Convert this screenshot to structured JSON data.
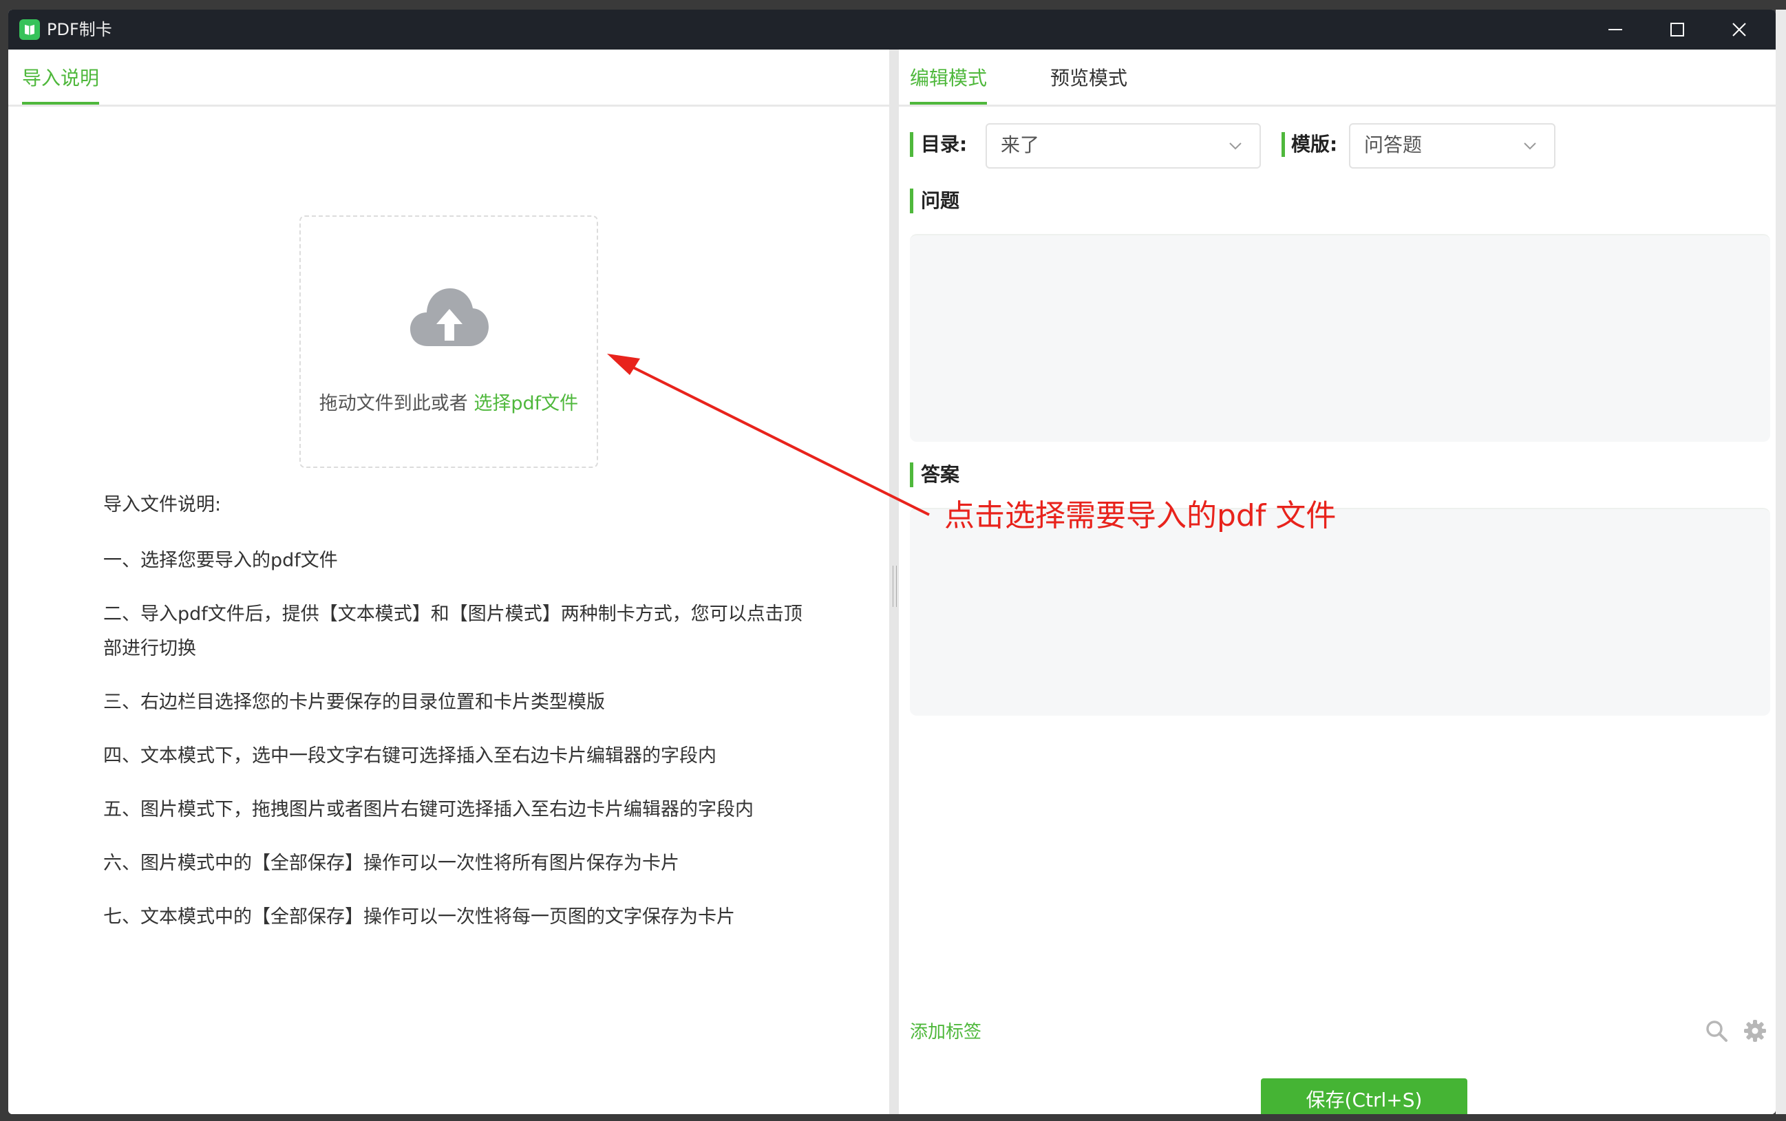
{
  "window": {
    "title": "PDF制卡"
  },
  "left_panel": {
    "tabs": [
      {
        "label": "导入说明",
        "active": true
      }
    ],
    "upload": {
      "text": "拖动文件到此或者",
      "link": "选择pdf文件",
      "icon": "cloud-upload-icon"
    },
    "instructions": {
      "title": "导入文件说明:",
      "items": [
        "一、选择您要导入的pdf文件",
        "二、导入pdf文件后，提供【文本模式】和【图片模式】两种制卡方式，您可以点击顶部进行切换",
        "三、右边栏目选择您的卡片要保存的目录位置和卡片类型模版",
        "四、文本模式下，选中一段文字右键可选择插入至右边卡片编辑器的字段内",
        "五、图片模式下，拖拽图片或者图片右键可选择插入至右边卡片编辑器的字段内",
        "六、图片模式中的【全部保存】操作可以一次性将所有图片保存为卡片",
        "七、文本模式中的【全部保存】操作可以一次性将每一页图的文字保存为卡片"
      ]
    }
  },
  "right_panel": {
    "tabs": [
      {
        "label": "编辑模式",
        "active": true
      },
      {
        "label": "预览模式",
        "active": false
      }
    ],
    "directory": {
      "label": "目录:",
      "value": "来了"
    },
    "template": {
      "label": "模版:",
      "value": "问答题"
    },
    "fields": [
      {
        "label": "问题"
      },
      {
        "label": "答案"
      }
    ],
    "add_tag": "添加标签",
    "save_button": "保存(Ctrl+S)"
  },
  "annotation": {
    "text": "点击选择需要导入的pdf 文件",
    "color": "#e8231c"
  },
  "colors": {
    "accent": "#4fb83c",
    "titlebar": "#1f232a",
    "save": "#45b434"
  }
}
